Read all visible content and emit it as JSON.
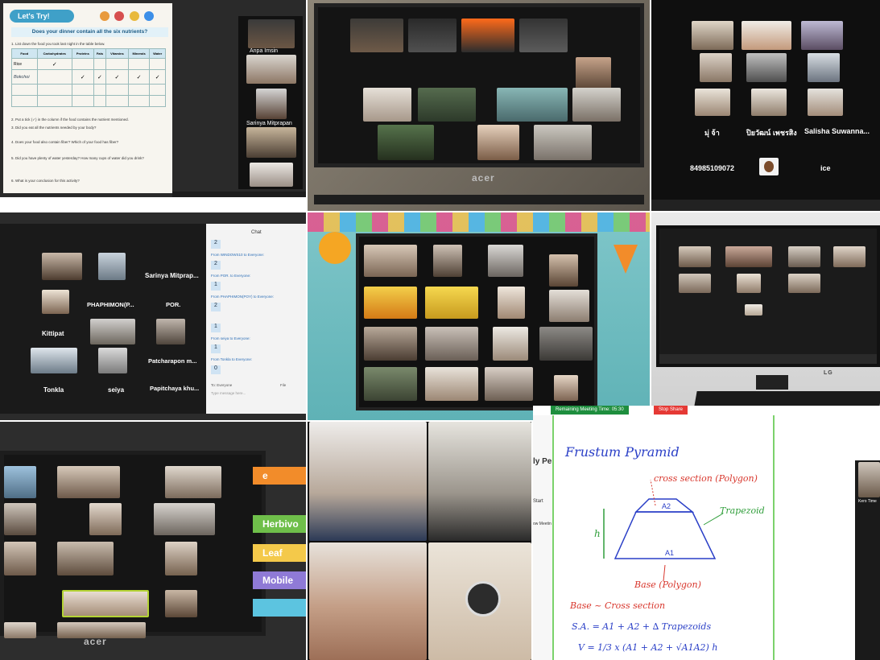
{
  "tiles": {
    "t1": {
      "worksheet_title": "Let's Try!",
      "worksheet_question": "Does your dinner contain all the six nutrients?",
      "instruction1": "1. List down the food you took last night in the table below.",
      "table_headers": [
        "Food",
        "Carbohydrates",
        "Proteins",
        "Fats",
        "Vitamins",
        "Minerals",
        "Water"
      ],
      "rows": [
        "Rice",
        "Bokchoi"
      ],
      "q2": "2. Put a tick (✓) in the column if the food contains the nutrient mentioned.",
      "q3": "3. Did you eat all the nutrients needed by your body?",
      "q4": "4. Does your food also contain fiber? Which of your food has fiber?",
      "q5": "5. Did you have plenty of water yesterday? How many cups of water did you drink?",
      "q6": "6. What is your conclusion for this activity?",
      "participants": [
        "Anpa Imsin",
        "Sarinya Mitprapan"
      ]
    },
    "t2": {
      "brand": "acer"
    },
    "t3": {
      "names": [
        "มุ่ จ้า",
        "ปิยวัฒน์ เพชรสิง",
        "Salisha Suwanna...",
        "84985109072",
        "ice"
      ]
    },
    "t4": {
      "chat_title": "Chat",
      "grid_names": [
        "Sarinya Mitprap...",
        "PHAPHIMON(P...",
        "POR.",
        "Kittipat",
        "Patcharapon m...",
        "Tonkla",
        "seiya",
        "Papitchaya khu..."
      ],
      "chat_numbers": [
        "2",
        "2",
        "1",
        "2",
        "1",
        "1",
        "0"
      ],
      "chat_lines": [
        "From WINDOWS10 to Everyone:",
        "From POR. to Everyone:",
        "From PHAPHIMON(POY) to Everyone:",
        "From seiya to Everyone:",
        "From Tonkla to Everyone:"
      ],
      "to_label": "To: Everyone",
      "file_label": "File",
      "input_placeholder": "Type message here..."
    },
    "t5": {},
    "t6": {
      "brand": "LG"
    },
    "t7": {
      "brand": "acer",
      "side_words": [
        "e",
        "Herbivo",
        "Leaf",
        "Mobile"
      ]
    },
    "t8": {},
    "t9": {
      "meeting_time": "Remaining Meeting Time: 05:30",
      "stop_share": "Stop Share",
      "side_text": [
        "ly Pe",
        "Start",
        "ow Meetin"
      ],
      "side_name": "Kero Time",
      "title": "Frustum Pyramid",
      "cross_section": "cross section (Polygon)",
      "trapezoid": "Trapezoid",
      "h": "h",
      "a1": "A1",
      "a2": "A2",
      "base": "Base (Polygon)",
      "base_eq": "Base ~ Cross section",
      "sa": "S.A. = A1 + A2 + ∆ Trapezoids",
      "v": "V = 1/3 x (A1 + A2 + √A1A2) h"
    }
  },
  "colors": {
    "dark_screen": "#1c1c1c",
    "note_ink": "#2a3fc7",
    "note_red": "#d8362c",
    "note_green": "#2f9e3a",
    "stop_red": "#e53935",
    "zoom_green": "#1e8e3e"
  }
}
